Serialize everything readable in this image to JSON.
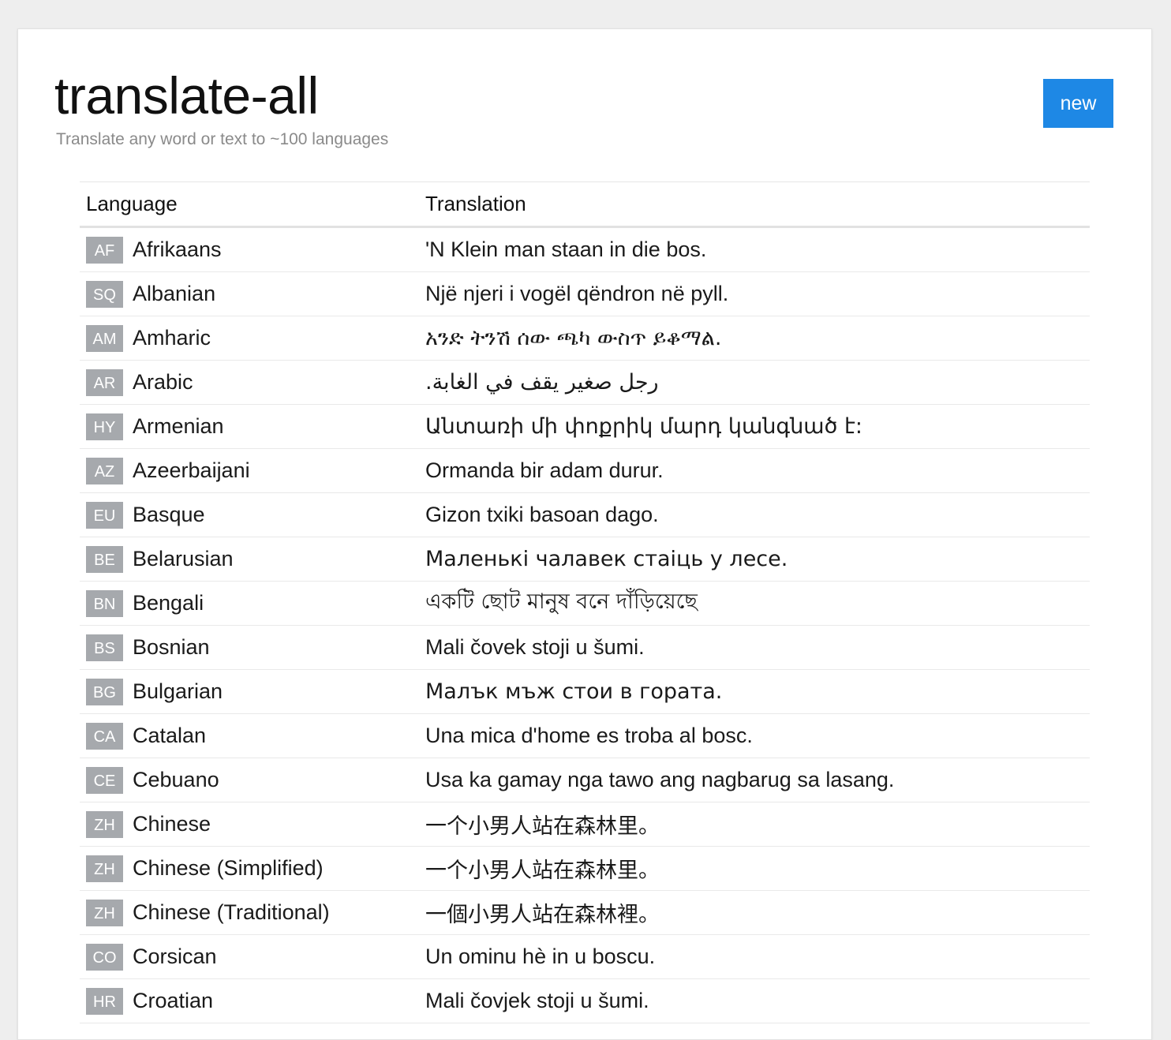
{
  "header": {
    "title": "translate-all",
    "subtitle": "Translate any word or text to ~100 languages",
    "new_button_label": "new"
  },
  "table": {
    "columns": [
      "Language",
      "Translation"
    ],
    "rows": [
      {
        "code": "AF",
        "language": "Afrikaans",
        "translation": "'N Klein man staan in die bos."
      },
      {
        "code": "SQ",
        "language": "Albanian",
        "translation": "Një njeri i vogël qëndron në pyll."
      },
      {
        "code": "AM",
        "language": "Amharic",
        "translation": "አንድ ትንሽ ሰው ጫካ ውስጥ ይቆማል."
      },
      {
        "code": "AR",
        "language": "Arabic",
        "translation": "رجل صغير يقف في الغابة."
      },
      {
        "code": "HY",
        "language": "Armenian",
        "translation": "Անտառի մի փոքրիկ մարդ կանգնած է:"
      },
      {
        "code": "AZ",
        "language": "Azeerbaijani",
        "translation": "Ormanda bir adam durur."
      },
      {
        "code": "EU",
        "language": "Basque",
        "translation": "Gizon txiki basoan dago."
      },
      {
        "code": "BE",
        "language": "Belarusian",
        "translation": "Маленькі чалавек стаіць у лесе."
      },
      {
        "code": "BN",
        "language": "Bengali",
        "translation": "একটি ছোট মানুষ বনে দাঁড়িয়েছে"
      },
      {
        "code": "BS",
        "language": "Bosnian",
        "translation": "Mali čovek stoji u šumi."
      },
      {
        "code": "BG",
        "language": "Bulgarian",
        "translation": "Малък мъж стои в гората."
      },
      {
        "code": "CA",
        "language": "Catalan",
        "translation": "Una mica d'home es troba al bosc."
      },
      {
        "code": "CE",
        "language": "Cebuano",
        "translation": "Usa ka gamay nga tawo ang nagbarug sa lasang."
      },
      {
        "code": "ZH",
        "language": "Chinese",
        "translation": "一个小男人站在森林里。"
      },
      {
        "code": "ZH",
        "language": "Chinese (Simplified)",
        "translation": "一个小男人站在森林里。"
      },
      {
        "code": "ZH",
        "language": "Chinese (Traditional)",
        "translation": "一個小男人站在森林裡。"
      },
      {
        "code": "CO",
        "language": "Corsican",
        "translation": "Un ominu hè in u boscu."
      },
      {
        "code": "HR",
        "language": "Croatian",
        "translation": "Mali čovjek stoji u šumi."
      }
    ]
  }
}
